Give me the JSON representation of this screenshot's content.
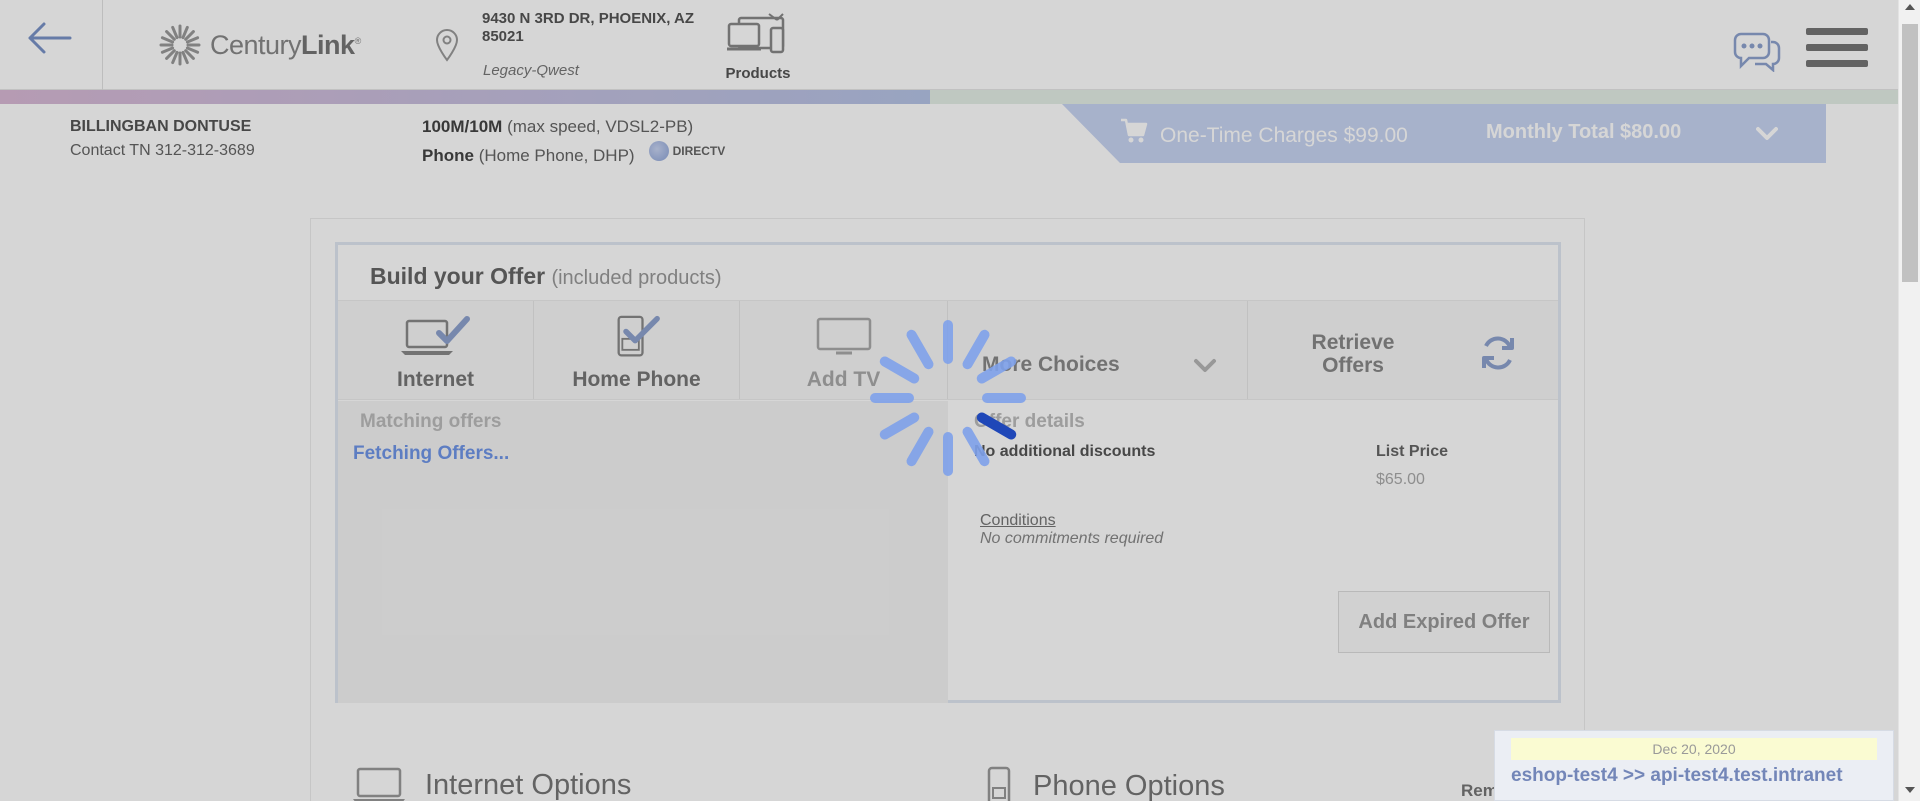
{
  "header": {
    "back_icon": "arrow-left-icon",
    "brand": {
      "light": "Century",
      "bold": "Link",
      "mark": "®"
    },
    "address_line": "9430 N 3RD DR, PHOENIX, AZ 85021",
    "address_sub": "Legacy-Qwest",
    "products_label": "Products",
    "chat_icon": "chat-bubbles-icon",
    "menu_icon": "hamburger-menu-icon"
  },
  "progress": {
    "completed_fraction": 0.49
  },
  "customer": {
    "name": "BILLINGBAN DONTUSE",
    "contact": "Contact TN 312-312-3689"
  },
  "services": {
    "internet_bold": "100M/10M",
    "internet_detail": "(max speed, VDSL2-PB)",
    "phone_bold": "Phone",
    "phone_detail": "(Home Phone, DHP)",
    "partner": "DIRECTV"
  },
  "totals": {
    "one_time": "One-Time Charges $99.00",
    "monthly": "Monthly Total $80.00"
  },
  "offer": {
    "title": "Build your Offer",
    "title_note": "(included products)",
    "tabs": {
      "internet": "Internet",
      "home_phone": "Home Phone",
      "add_tv": "Add TV",
      "more_choices": "More Choices",
      "retrieve": "Retrieve Offers"
    },
    "matching_title": "Matching offers",
    "fetching": "Fetching Offers...",
    "details_title": "Offer details",
    "discounts": "No additional discounts",
    "list_price_label": "List Price",
    "list_price": "$65.00",
    "conditions": "Conditions",
    "no_commitments": "No commitments required",
    "add_expired_button": "Add Expired Offer"
  },
  "sections": {
    "internet_options": "Internet Options",
    "phone_options": "Phone Options",
    "remove": "Remove"
  },
  "env": {
    "date": "Dec 20, 2020",
    "server": "eshop-test4 >> api-test4.test.intranet"
  },
  "colors": {
    "accent_blue": "#6f96e8",
    "spinner_dark": "#1f47b8",
    "spinner_light": "#7ea1ea",
    "totals_bar": "#c8d4f2"
  },
  "state": {
    "loading": true
  }
}
